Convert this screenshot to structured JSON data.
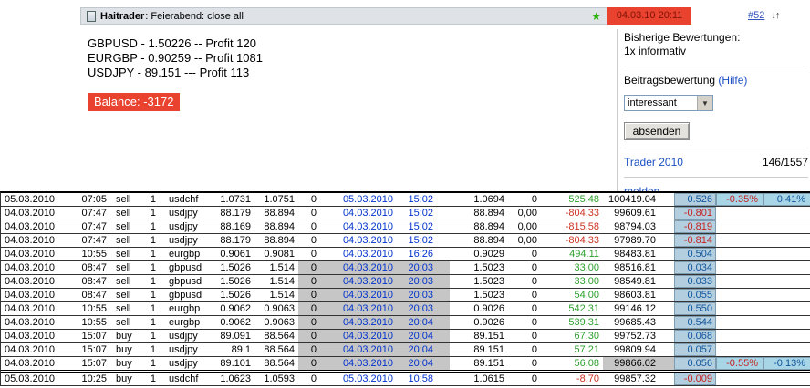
{
  "header": {
    "author": "Haitrader",
    "subject": ": Feierabend: close all",
    "datetime": "04.03.10 20:11",
    "post_number": "#52"
  },
  "icons": {
    "star": "★",
    "nav_arrows": "↓↑",
    "dropdown_arrow": "▼",
    "post_icon": "document-page"
  },
  "colors": {
    "accent_red": "#e9422e",
    "link_blue": "#0033cc",
    "profit_green": "#2da02d",
    "loss_red": "#cc3322",
    "ratio_cell_bg": "#b3cfdf",
    "percent_cell_bg": "#a9d6e6",
    "gray_highlight": "#c6c6c6"
  },
  "body": {
    "lines": [
      "GBPUSD - 1.50226 -- Profit 120",
      "EURGBP - 0.90259 -- Profit 1081",
      "USDJPY - 89.151 --- Profit 113"
    ],
    "balance_text": "Balance: -3172"
  },
  "sidebar": {
    "ratings_label": "Bisherige Bewertungen:",
    "ratings_value": "1x informativ",
    "rating_section_label": "Beitragsbewertung",
    "help_link": "(Hilfe)",
    "rating_select_value": "interessant",
    "submit_button": "absenden",
    "trader_link": "Trader 2010",
    "trader_count": "146/1557",
    "report_link": "melden"
  },
  "table": {
    "columns": [
      "open-date",
      "open-time",
      "trade-side",
      "lots",
      "symbol",
      "open-price",
      "price-2",
      "zero-flag",
      "close-date",
      "close-time",
      "close-price",
      "zero-2",
      "profit",
      "balance",
      "profit-percent",
      "summary-percent-1",
      "summary-percent-2"
    ],
    "rows": [
      {
        "cells": [
          "05.03.2010",
          "07:05",
          "sell",
          "1",
          "usdchf",
          "1.0731",
          "1.0751",
          "0",
          "05.03.2010",
          "15:02",
          "1.0694",
          "0",
          "525.48",
          "100419.04",
          "0.526",
          "-0.35%",
          "0.41%"
        ],
        "gray_band": false,
        "gray_balance": false,
        "thick_bottom": false,
        "pct1_color": "red",
        "pct2_color": "blue"
      },
      {
        "cells": [
          "04.03.2010",
          "07:47",
          "sell",
          "1",
          "usdjpy",
          "88.179",
          "88.894",
          "0",
          "04.03.2010",
          "15:02",
          "88.894",
          "0,00",
          "-804.33",
          "99609.61",
          "-0.801",
          "",
          ""
        ],
        "gray_band": false,
        "gray_balance": false,
        "thick_bottom": false,
        "pct1_color": "",
        "pct2_color": ""
      },
      {
        "cells": [
          "04.03.2010",
          "07:47",
          "sell",
          "1",
          "usdjpy",
          "88.169",
          "88.894",
          "0",
          "04.03.2010",
          "15:02",
          "88.894",
          "0,00",
          "-815.58",
          "98794.03",
          "-0.819",
          "",
          ""
        ],
        "gray_band": false,
        "gray_balance": false,
        "thick_bottom": false,
        "pct1_color": "",
        "pct2_color": ""
      },
      {
        "cells": [
          "04.03.2010",
          "07:47",
          "sell",
          "1",
          "usdjpy",
          "88.179",
          "88.894",
          "0",
          "04.03.2010",
          "15:02",
          "88.894",
          "0,00",
          "-804.33",
          "97989.70",
          "-0.814",
          "",
          ""
        ],
        "gray_band": false,
        "gray_balance": false,
        "thick_bottom": false,
        "pct1_color": "",
        "pct2_color": ""
      },
      {
        "cells": [
          "04.03.2010",
          "10:55",
          "sell",
          "1",
          "eurgbp",
          "0.9061",
          "0.9081",
          "0",
          "04.03.2010",
          "16:26",
          "0.9029",
          "0",
          "494.11",
          "98483.81",
          "0.504",
          "",
          ""
        ],
        "gray_band": false,
        "gray_balance": false,
        "thick_bottom": false,
        "pct1_color": "",
        "pct2_color": ""
      },
      {
        "cells": [
          "04.03.2010",
          "08:47",
          "sell",
          "1",
          "gbpusd",
          "1.5026",
          "1.514",
          "0",
          "04.03.2010",
          "20:03",
          "1.5023",
          "0",
          "33.00",
          "98516.81",
          "0.034",
          "",
          ""
        ],
        "gray_band": true,
        "gray_balance": false,
        "thick_bottom": false,
        "pct1_color": "",
        "pct2_color": ""
      },
      {
        "cells": [
          "04.03.2010",
          "08:47",
          "sell",
          "1",
          "gbpusd",
          "1.5026",
          "1.514",
          "0",
          "04.03.2010",
          "20:03",
          "1.5023",
          "0",
          "33.00",
          "98549.81",
          "0.033",
          "",
          ""
        ],
        "gray_band": true,
        "gray_balance": false,
        "thick_bottom": false,
        "pct1_color": "",
        "pct2_color": ""
      },
      {
        "cells": [
          "04.03.2010",
          "08:47",
          "sell",
          "1",
          "gbpusd",
          "1.5026",
          "1.514",
          "0",
          "04.03.2010",
          "20:03",
          "1.5023",
          "0",
          "54.00",
          "98603.81",
          "0.055",
          "",
          ""
        ],
        "gray_band": true,
        "gray_balance": false,
        "thick_bottom": false,
        "pct1_color": "",
        "pct2_color": ""
      },
      {
        "cells": [
          "04.03.2010",
          "10:55",
          "sell",
          "1",
          "eurgbp",
          "0.9062",
          "0.9063",
          "0",
          "04.03.2010",
          "20:03",
          "0.9026",
          "0",
          "542.31",
          "99146.12",
          "0.550",
          "",
          ""
        ],
        "gray_band": true,
        "gray_balance": false,
        "thick_bottom": false,
        "pct1_color": "",
        "pct2_color": ""
      },
      {
        "cells": [
          "04.03.2010",
          "10:55",
          "sell",
          "1",
          "eurgbp",
          "0.9062",
          "0.9063",
          "0",
          "04.03.2010",
          "20:04",
          "0.9026",
          "0",
          "539.31",
          "99685.43",
          "0.544",
          "",
          ""
        ],
        "gray_band": true,
        "gray_balance": false,
        "thick_bottom": false,
        "pct1_color": "",
        "pct2_color": ""
      },
      {
        "cells": [
          "04.03.2010",
          "15:07",
          "buy",
          "1",
          "usdjpy",
          "89.091",
          "88.564",
          "0",
          "04.03.2010",
          "20:04",
          "89.151",
          "0",
          "67.30",
          "99752.73",
          "0.068",
          "",
          ""
        ],
        "gray_band": true,
        "gray_balance": false,
        "thick_bottom": false,
        "pct1_color": "",
        "pct2_color": ""
      },
      {
        "cells": [
          "04.03.2010",
          "15:07",
          "buy",
          "1",
          "usdjpy",
          "89.1",
          "88.564",
          "0",
          "04.03.2010",
          "20:04",
          "89.151",
          "0",
          "57.21",
          "99809.94",
          "0.057",
          "",
          ""
        ],
        "gray_band": true,
        "gray_balance": false,
        "thick_bottom": false,
        "pct1_color": "",
        "pct2_color": ""
      },
      {
        "cells": [
          "04.03.2010",
          "15:07",
          "buy",
          "1",
          "usdjpy",
          "89.101",
          "88.564",
          "0",
          "04.03.2010",
          "20:04",
          "89.151",
          "0",
          "56.08",
          "99866.02",
          "0.056",
          "-0.55%",
          "-0.13%"
        ],
        "gray_band": true,
        "gray_balance": true,
        "thick_bottom": true,
        "pct1_color": "red",
        "pct2_color": "blue"
      },
      {
        "cells": [
          "05.03.2010",
          "10:25",
          "buy",
          "1",
          "usdchf",
          "1.0623",
          "1.0593",
          "0",
          "05.03.2010",
          "10:58",
          "1.0615",
          "0",
          "-8.70",
          "99857.32",
          "-0.009",
          "",
          ""
        ],
        "gray_band": false,
        "gray_balance": false,
        "thick_bottom": false,
        "pct1_color": "",
        "pct2_color": ""
      }
    ]
  }
}
